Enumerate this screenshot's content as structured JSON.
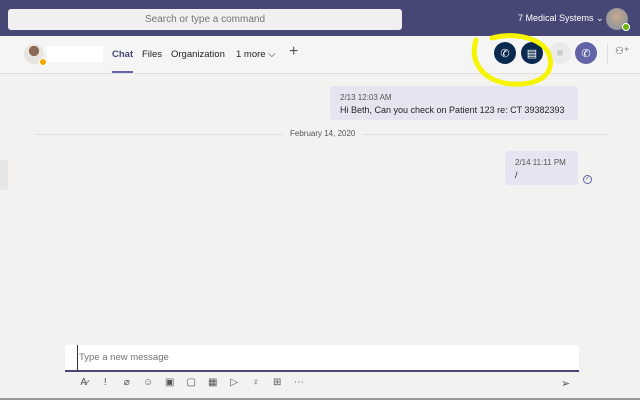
{
  "search": {
    "placeholder": "Search or type a command"
  },
  "org": {
    "name": "7 Medical Systems ⌄"
  },
  "tabs": [
    {
      "label": "Chat"
    },
    {
      "label": "Files"
    },
    {
      "label": "Organization"
    },
    {
      "label": "1 more ⌵"
    }
  ],
  "add_tab": "+",
  "messages": [
    {
      "time": "2/13 12:03 AM",
      "text": "Hi Beth, Can you check on Patient 123 re: CT 39382393"
    },
    {
      "time": "2/14 11:11 PM",
      "text": "/"
    }
  ],
  "date_divider": "February 14, 2020",
  "compose": {
    "placeholder": "Type a new message"
  },
  "colors": {
    "topbar": "#464775",
    "accent": "#6264a7",
    "highlight": "#f5f500",
    "call_dark": "#0b2a4f"
  }
}
